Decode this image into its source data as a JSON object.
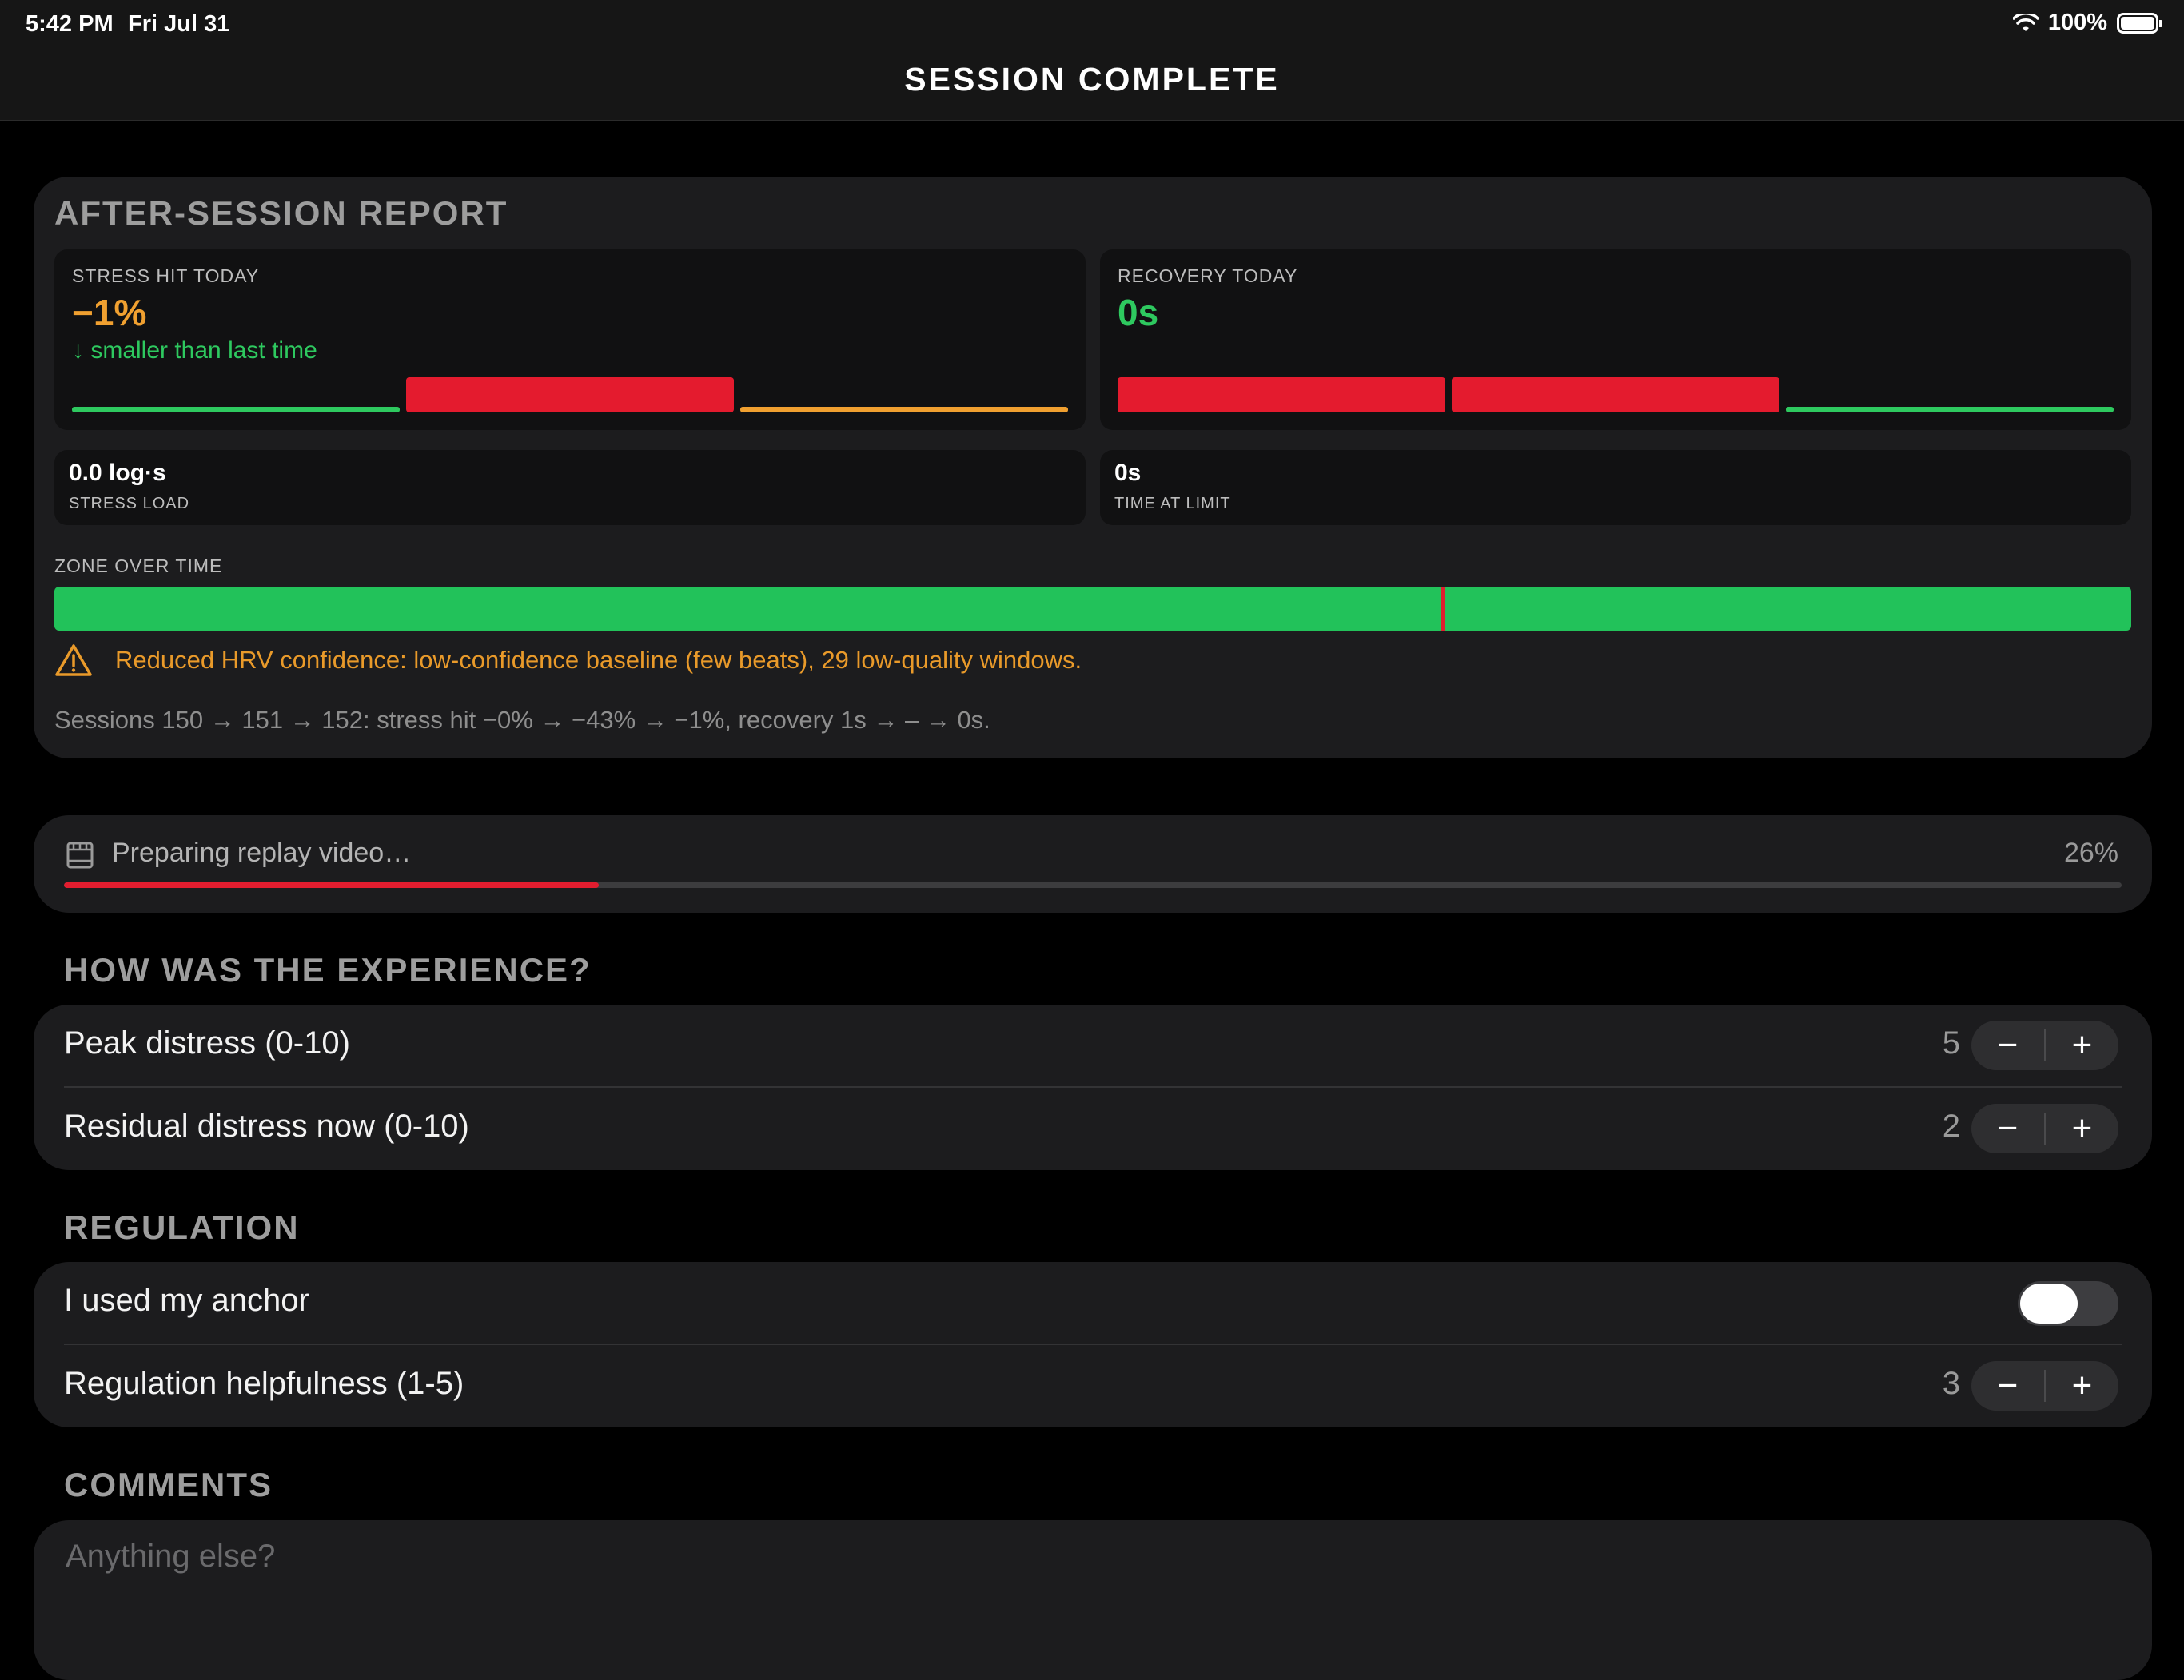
{
  "status_bar": {
    "time": "5:42 PM",
    "date": "Fri Jul 31",
    "battery": "100%"
  },
  "nav": {
    "title": "SESSION COMPLETE"
  },
  "report": {
    "title": "AFTER-SESSION REPORT",
    "stress_hit": {
      "label": "STRESS HIT TODAY",
      "value": "−1%",
      "delta": "↓  smaller than last time",
      "bars": [
        {
          "style": "thin",
          "color": "#2ec95f"
        },
        {
          "style": "thick",
          "color": "#e41b2e"
        },
        {
          "style": "thin",
          "color": "#f0a030"
        }
      ]
    },
    "recovery": {
      "label": "RECOVERY TODAY",
      "value": "0s",
      "bars": [
        {
          "style": "thick",
          "color": "#e41b2e"
        },
        {
          "style": "thick",
          "color": "#e41b2e"
        },
        {
          "style": "thin",
          "color": "#2ec95f"
        }
      ]
    },
    "stress_load": {
      "value": "0.0 log·s",
      "label": "STRESS LOAD"
    },
    "time_at_limit": {
      "value": "0s",
      "label": "TIME AT LIMIT"
    },
    "zone": {
      "label": "ZONE OVER TIME",
      "color": "#22c25a",
      "marker_fraction": 0.668,
      "marker_color": "#e21d2f"
    },
    "warning": "Reduced HRV confidence: low-confidence baseline (few beats), 29 low-quality windows.",
    "sessions_summary": "Sessions 150 → 151 → 152: stress hit −0% → −43% → −1%, recovery 1s → – → 0s."
  },
  "replay": {
    "text": "Preparing replay video…",
    "percent_label": "26%",
    "progress": 0.26
  },
  "experience": {
    "title": "HOW WAS THE EXPERIENCE?",
    "peak": {
      "label": "Peak distress (0-10)",
      "value": "5"
    },
    "residual": {
      "label": "Residual distress now (0-10)",
      "value": "2"
    }
  },
  "regulation": {
    "title": "REGULATION",
    "anchor": {
      "label": "I used my anchor",
      "on": false
    },
    "helpfulness": {
      "label": "Regulation helpfulness (1-5)",
      "value": "3"
    }
  },
  "comments": {
    "title": "COMMENTS",
    "placeholder": "Anything else?"
  },
  "stepper": {
    "minus": "−",
    "plus": "+"
  }
}
